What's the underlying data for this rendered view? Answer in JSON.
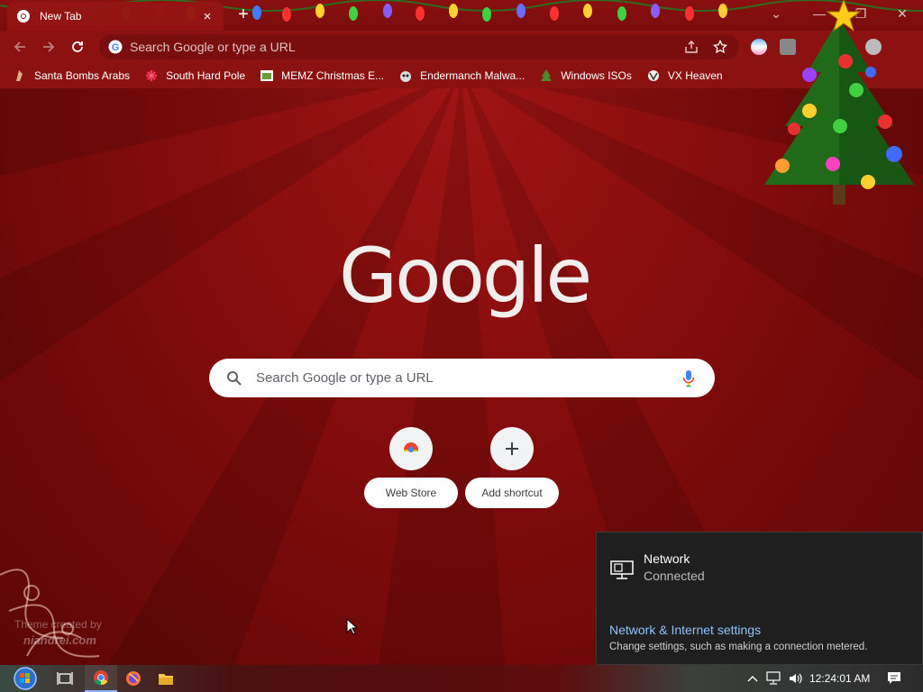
{
  "browser": {
    "tab": {
      "title": "New Tab",
      "close": "×"
    },
    "new_tab": "+",
    "window_controls": {
      "tab_search": "⌄",
      "minimize": "—",
      "maximize": "❐",
      "close": "✕"
    },
    "omnibox": {
      "placeholder": "Search Google or type a URL"
    },
    "bookmarks": [
      {
        "label": "Santa Bombs Arabs",
        "icon": "santa-icon"
      },
      {
        "label": "South Hard Pole",
        "icon": "snowflake-icon"
      },
      {
        "label": "MEMZ Christmas E...",
        "icon": "image-icon"
      },
      {
        "label": "Endermanch Malwa...",
        "icon": "raccoon-icon"
      },
      {
        "label": "Windows ISOs",
        "icon": "tree-icon"
      },
      {
        "label": "VX Heaven",
        "icon": "vx-icon"
      }
    ]
  },
  "ntp": {
    "logo": "Google",
    "search_placeholder": "Search Google or type a URL",
    "shortcuts": [
      {
        "label": "Web Store",
        "icon": "webstore-icon"
      },
      {
        "label": "Add shortcut",
        "icon": "plus-icon"
      }
    ],
    "theme_credit": {
      "line1": "Theme created by",
      "line2": "niandrei.com"
    }
  },
  "network_flyout": {
    "name": "Network",
    "status": "Connected",
    "link": "Network & Internet settings",
    "description": "Change settings, such as making a connection metered."
  },
  "taskbar": {
    "clock": "12:24:01 AM"
  },
  "colors": {
    "theme_red": "#8c1212",
    "background": "#830c0c",
    "flyout_bg": "#1f1f1f",
    "link_blue": "#8fc3ff"
  }
}
